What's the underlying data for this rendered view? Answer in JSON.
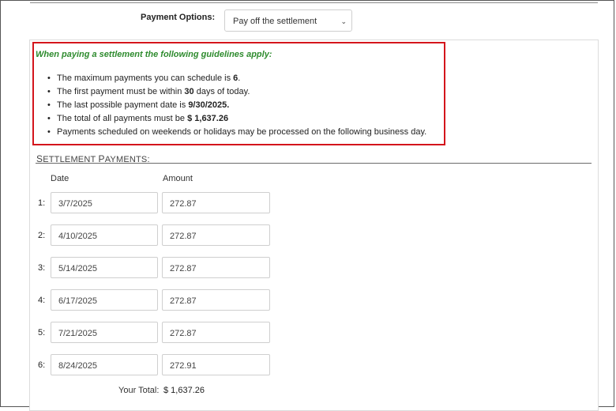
{
  "payment_options": {
    "label": "Payment Options:",
    "selected": "Pay off the settlement"
  },
  "guidelines": {
    "title": "When paying a settlement the following guidelines apply:",
    "items": [
      {
        "prefix": "The maximum payments you can schedule is ",
        "bold": "6",
        "suffix": "."
      },
      {
        "prefix": "The first payment must be within ",
        "bold": "30",
        "suffix": " days of today."
      },
      {
        "prefix": "The last possible payment date is ",
        "bold": "9/30/2025.",
        "suffix": ""
      },
      {
        "prefix": "The total of all payments must be ",
        "bold": "$ 1,637.26",
        "suffix": ""
      },
      {
        "prefix": "Payments scheduled on weekends or holidays may be processed on the following business day.",
        "bold": "",
        "suffix": ""
      }
    ]
  },
  "section": {
    "title_first_s": "S",
    "title_rest_1": "ETTLEMENT ",
    "title_first_p": "P",
    "title_rest_2": "AYMENTS:"
  },
  "columns": {
    "date": "Date",
    "amount": "Amount"
  },
  "payments": [
    {
      "num": "1:",
      "date": "3/7/2025",
      "amount": "272.87"
    },
    {
      "num": "2:",
      "date": "4/10/2025",
      "amount": "272.87"
    },
    {
      "num": "3:",
      "date": "5/14/2025",
      "amount": "272.87"
    },
    {
      "num": "4:",
      "date": "6/17/2025",
      "amount": "272.87"
    },
    {
      "num": "5:",
      "date": "7/21/2025",
      "amount": "272.87"
    },
    {
      "num": "6:",
      "date": "8/24/2025",
      "amount": "272.91"
    }
  ],
  "total": {
    "label": "Your Total:",
    "value": "$ 1,637.26"
  }
}
